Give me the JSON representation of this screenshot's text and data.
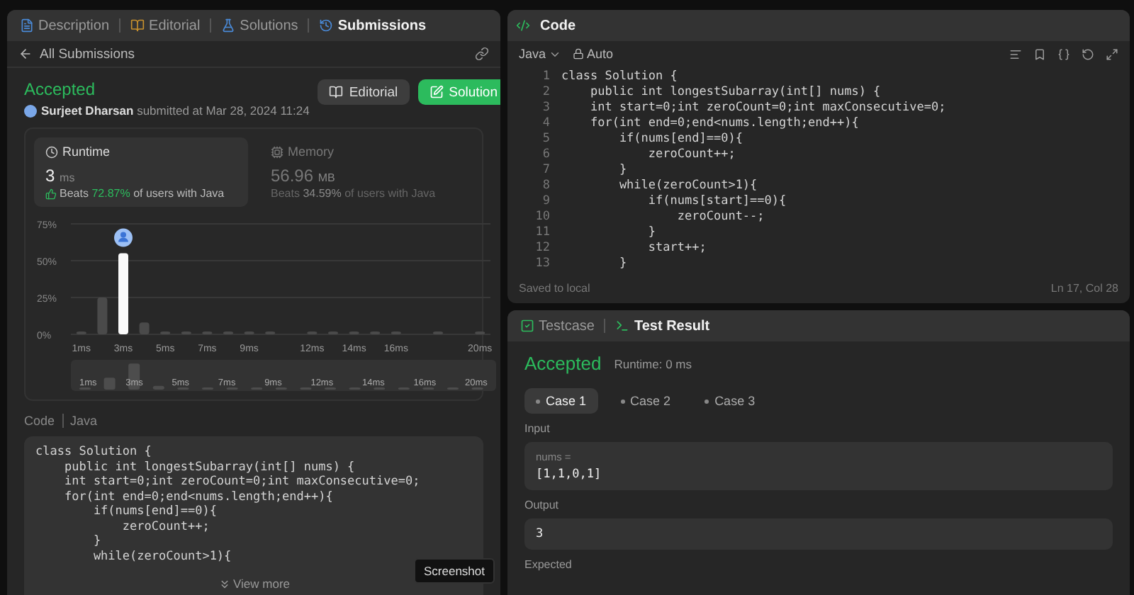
{
  "left_panel": {
    "tabs": [
      {
        "label": "Description",
        "selected": false
      },
      {
        "label": "Editorial",
        "selected": false
      },
      {
        "label": "Solutions",
        "selected": false
      },
      {
        "label": "Submissions",
        "selected": true
      }
    ],
    "back_link": "All Submissions",
    "submission": {
      "status": "Accepted",
      "author": "Surjeet Dharsan",
      "submitted_text": "submitted at Mar 28, 2024 11:24"
    },
    "buttons": [
      {
        "label": "Editorial",
        "kind": "secondary"
      },
      {
        "label": "Solution",
        "kind": "primary"
      }
    ],
    "stats": [
      {
        "title": "Runtime",
        "value": "3",
        "unit": "ms",
        "beats_prefix": "Beats",
        "beats_value": "72.87%",
        "beats_suffix": "of users with Java",
        "selected": true
      },
      {
        "title": "Memory",
        "value": "56.96",
        "unit": "MB",
        "beats_prefix": "Beats",
        "beats_value": "34.59%",
        "beats_suffix": "of users with Java",
        "selected": false
      }
    ],
    "chart_data": {
      "type": "bar",
      "x": [
        1,
        2,
        3,
        4,
        5,
        6,
        7,
        8,
        9,
        10,
        12,
        13,
        14,
        15,
        16,
        18,
        20
      ],
      "xlim": [
        0.5,
        20.5
      ],
      "values": [
        1,
        25,
        55,
        8,
        1,
        1,
        1,
        1,
        1,
        1,
        1,
        1,
        1,
        1,
        1,
        1,
        1
      ],
      "ylim": [
        0,
        75
      ],
      "yticks": [
        {
          "value": 0,
          "label": "0%"
        },
        {
          "value": 25,
          "label": "25%"
        },
        {
          "value": 50,
          "label": "50%"
        },
        {
          "value": 75,
          "label": "75%"
        }
      ],
      "xticks": [
        {
          "value": 1,
          "label": "1ms"
        },
        {
          "value": 3,
          "label": "3ms"
        },
        {
          "value": 5,
          "label": "5ms"
        },
        {
          "value": 7,
          "label": "7ms"
        },
        {
          "value": 9,
          "label": "9ms"
        },
        {
          "value": 12,
          "label": "12ms"
        },
        {
          "value": 14,
          "label": "14ms"
        },
        {
          "value": 16,
          "label": "16ms"
        },
        {
          "value": 20,
          "label": "20ms"
        }
      ]
    },
    "overview_labels": [
      "1ms",
      "3ms",
      "5ms",
      "7ms",
      "9ms",
      "12ms",
      "14ms",
      "16ms",
      "20ms"
    ],
    "code_header": {
      "title": "Code",
      "language": "Java"
    },
    "code_lines": [
      "class Solution {",
      "    public int longestSubarray(int[] nums) {",
      "    int start=0;int zeroCount=0;int maxConsecutive=0;",
      "    for(int end=0;end<nums.length;end++){",
      "        if(nums[end]==0){",
      "            zeroCount++;",
      "        }",
      "        while(zeroCount>1){"
    ],
    "view_more": "View more"
  },
  "editor": {
    "title": "Code",
    "language": "Java",
    "mode": "Auto",
    "line_numbers": [
      "1",
      "2",
      "3",
      "4",
      "5",
      "6",
      "7",
      "8",
      "9",
      "10",
      "11",
      "12",
      "13"
    ],
    "lines": [
      "class Solution {",
      "    public int longestSubarray(int[] nums) {",
      "    int start=0;int zeroCount=0;int maxConsecutive=0;",
      "    for(int end=0;end<nums.length;end++){",
      "        if(nums[end]==0){",
      "            zeroCount++;",
      "        }",
      "        while(zeroCount>1){",
      "            if(nums[start]==0){",
      "                zeroCount--;",
      "            }",
      "            start++;",
      "        }"
    ],
    "status": "Saved to local",
    "cursor": "Ln 17, Col 28"
  },
  "result_panel": {
    "tabs": [
      {
        "label": "Testcase",
        "selected": false
      },
      {
        "label": "Test Result",
        "selected": true
      }
    ],
    "status": "Accepted",
    "runtime": "Runtime: 0 ms",
    "cases": [
      {
        "label": "Case 1",
        "selected": true
      },
      {
        "label": "Case 2",
        "selected": false
      },
      {
        "label": "Case 3",
        "selected": false
      }
    ],
    "input_label": "Input",
    "input_name": "nums =",
    "input_value": "[1,1,0,1]",
    "output_label": "Output",
    "output_value": "3",
    "expected_label": "Expected"
  },
  "tooltip": "Screenshot"
}
